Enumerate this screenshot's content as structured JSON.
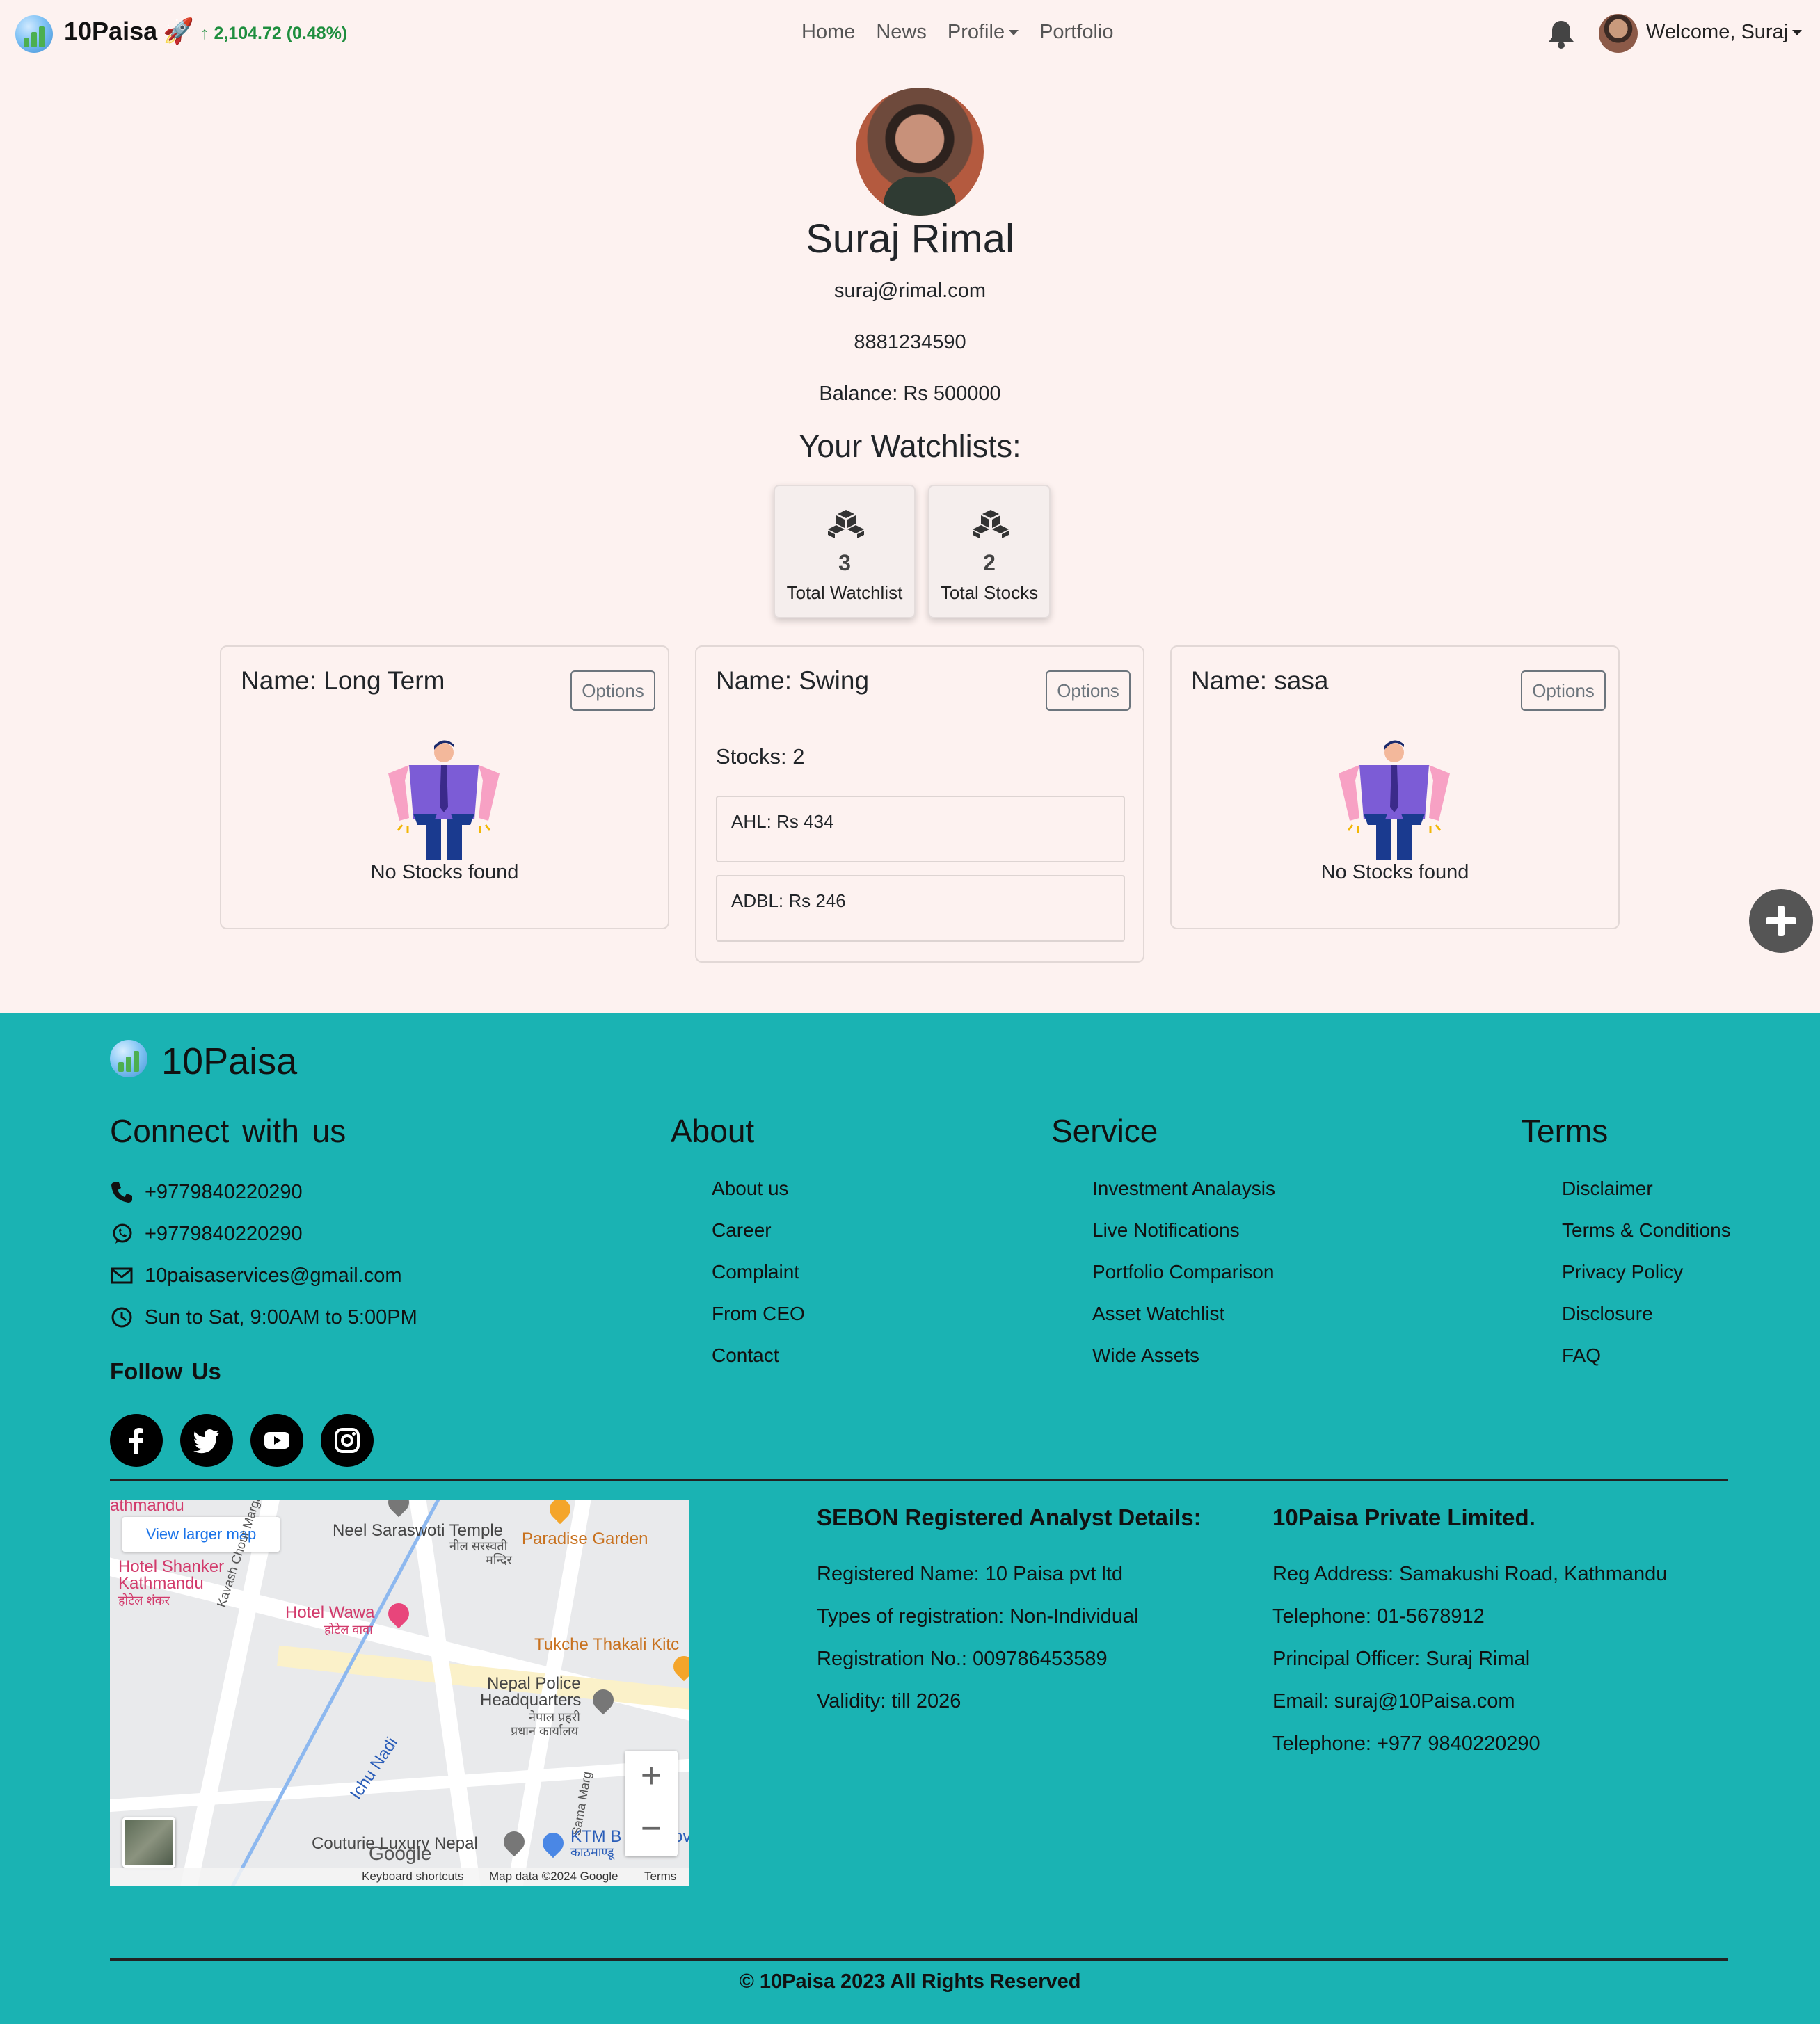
{
  "navbar": {
    "brand": "10Paisa",
    "ticker": "↑ 2,104.72 (0.48%)",
    "links": [
      "Home",
      "News",
      "Profile",
      "Portfolio"
    ],
    "welcome": "Welcome, Suraj"
  },
  "profile": {
    "name": "Suraj Rimal",
    "email": "suraj@rimal.com",
    "phone": "8881234590",
    "balance": "Balance: Rs 500000"
  },
  "watchlists_heading": "Your Watchlists:",
  "stats": [
    {
      "value": "3",
      "label": "Total Watchlist"
    },
    {
      "value": "2",
      "label": "Total Stocks"
    }
  ],
  "watchlists": [
    {
      "title": "Name: Long Term",
      "options": "Options",
      "empty_text": "No Stocks found"
    },
    {
      "title": "Name: Swing",
      "options": "Options",
      "stocks_count": "Stocks: 2",
      "stocks": [
        "AHL: Rs 434",
        "ADBL: Rs 246"
      ]
    },
    {
      "title": "Name: sasa",
      "options": "Options",
      "empty_text": "No Stocks found"
    }
  ],
  "footer": {
    "brand": "10Paisa",
    "connect_heading": "Connect with us",
    "contacts": [
      {
        "icon": "phone-icon",
        "text": "+9779840220290"
      },
      {
        "icon": "whatsapp-icon",
        "text": "+9779840220290"
      },
      {
        "icon": "mail-icon",
        "text": "10paisaservices@gmail.com"
      },
      {
        "icon": "clock-icon",
        "text": "Sun to Sat, 9:00AM to 5:00PM"
      }
    ],
    "follow_heading": "Follow Us",
    "social": [
      "facebook-icon",
      "twitter-icon",
      "youtube-icon",
      "instagram-icon"
    ],
    "about": {
      "heading": "About",
      "links": [
        "About us",
        "Career",
        "Complaint",
        "From CEO",
        "Contact"
      ]
    },
    "service": {
      "heading": "Service",
      "links": [
        "Investment Analaysis",
        "Live Notifications",
        "Portfolio Comparison",
        "Asset Watchlist",
        "Wide Assets"
      ]
    },
    "terms": {
      "heading": "Terms",
      "links": [
        "Disclaimer",
        "Terms & Conditions",
        "Privacy Policy",
        "Disclosure",
        "FAQ"
      ]
    },
    "map": {
      "view_larger": "View larger map",
      "labels": [
        "athmandu",
        "Neel Saraswoti Temple",
        "नील सरस्वती",
        "मन्दिर",
        "Paradise Garden",
        "Hotel Shanker",
        "Kathmandu",
        "होटेल शंकर",
        "Kavash Chour Marga",
        "Hotel Wawa",
        "होटेल वावा",
        "Tukche Thakali Kitc",
        "Nepal Police",
        "Headquarters",
        "नेपाल प्रहरी",
        "प्रधान कार्यालय",
        "Ichu Nadi",
        "Sama Marg",
        "Couturie Luxury Nepal",
        "KTM B",
        "काठमाण्डू",
        "ov"
      ],
      "google": "Google",
      "attribution": [
        "Keyboard shortcuts",
        "Map data ©2024 Google",
        "Terms"
      ],
      "zoom_in": "+",
      "zoom_out": "−"
    },
    "sebon": {
      "heading": "SEBON Registered Analyst Details:",
      "lines": [
        "Registered Name: 10 Paisa pvt ltd",
        "Types of registration: Non-Individual",
        "Registration No.: 009786453589",
        "Validity: till 2026"
      ]
    },
    "company": {
      "heading": "10Paisa Private Limited.",
      "lines": [
        "Reg Address: Samakushi Road, Kathmandu",
        "Telephone: 01-5678912",
        "Principal Officer: Suraj Rimal",
        "Email: suraj@10Paisa.com",
        "Telephone: +977 9840220290"
      ]
    },
    "copyright": "© 10Paisa 2023 All Rights Reserved"
  }
}
